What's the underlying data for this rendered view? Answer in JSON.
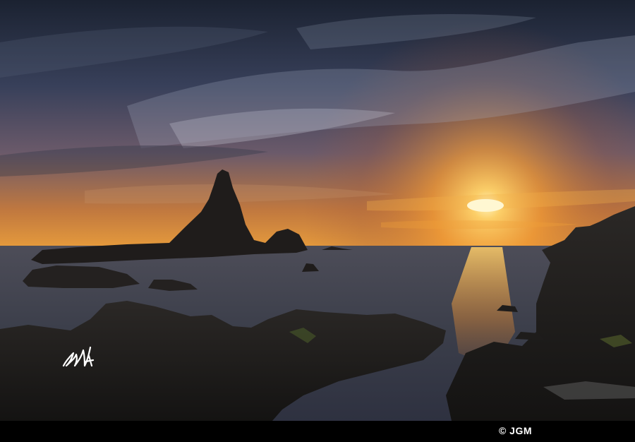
{
  "photo": {
    "subject": "coastal-sunset-seascape",
    "signature_text": "JGM",
    "colors": {
      "sky_top": "#1c2333",
      "sky_mid": "#3c4256",
      "horizon_glow": "#f0a23a",
      "sun": "#fff2b0",
      "sea": "#3a3d48",
      "rocks": "#1d1b1a"
    }
  },
  "footer": {
    "credit": "© JGM"
  }
}
